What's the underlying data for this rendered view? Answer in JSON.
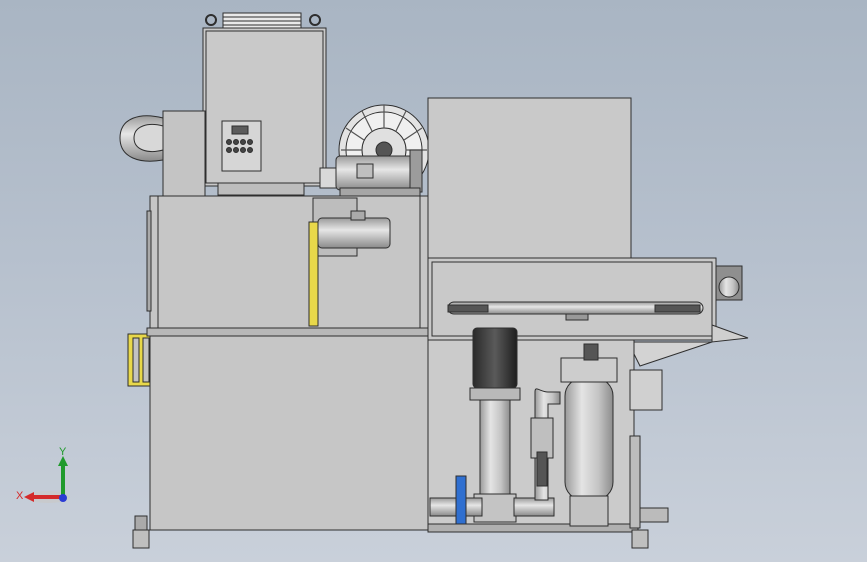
{
  "viewport": {
    "background_top": "#a9b5c3",
    "background_bottom": "#c9d0da"
  },
  "model": {
    "body_color": "#c7c7c7",
    "edge_color": "#2e2e2e",
    "accent_yellow": "#e8d84a",
    "accent_blue": "#2f6fd0"
  },
  "triad": {
    "x_label": "X",
    "y_label": "Y",
    "x_color": "#d42a2a",
    "y_color": "#1f9a2c",
    "z_color": "#2a3bd4"
  }
}
